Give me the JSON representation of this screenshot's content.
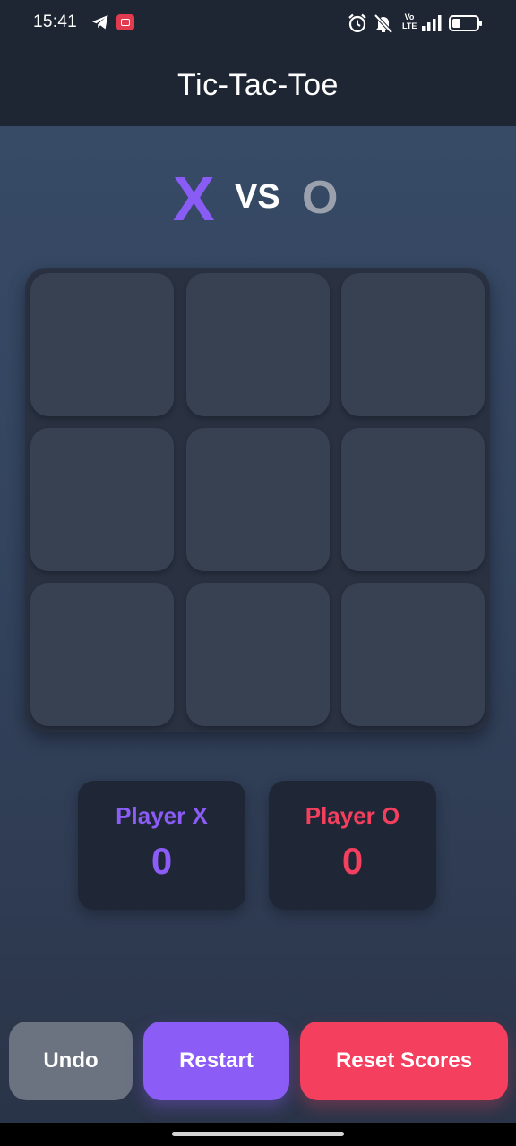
{
  "status_bar": {
    "time": "15:41",
    "left_icons": [
      "telegram-icon",
      "screen-record-icon"
    ],
    "right_icons": [
      "alarm-icon",
      "mute-icon",
      "volte-icon",
      "signal-icon",
      "battery-icon"
    ],
    "volte_label_top": "Vo",
    "volte_label_bottom": "LTE"
  },
  "header": {
    "title": "Tic-Tac-Toe"
  },
  "versus": {
    "player_x": "X",
    "vs_label": "VS",
    "player_o": "O"
  },
  "board": {
    "cells": [
      "",
      "",
      "",
      "",
      "",
      "",
      "",
      "",
      ""
    ]
  },
  "scores": {
    "x": {
      "label": "Player X",
      "value": "0"
    },
    "o": {
      "label": "Player O",
      "value": "0"
    }
  },
  "buttons": {
    "undo": "Undo",
    "restart": "Restart",
    "reset_scores": "Reset Scores"
  },
  "colors": {
    "accent_x": "#8b5cf6",
    "accent_o": "#f43f5e",
    "header_bg": "#1e2634",
    "cell_bg": "#374151",
    "undo_bg": "#6b7280"
  }
}
